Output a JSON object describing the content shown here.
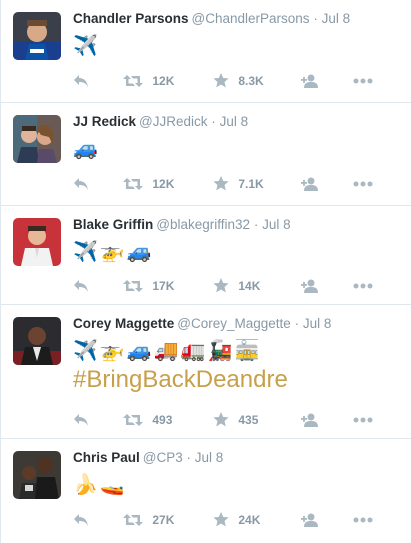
{
  "tweets": [
    {
      "name": "Chandler Parsons",
      "handle": "@ChandlerParsons",
      "sep": "·",
      "time": "Jul 8",
      "emojis": [
        "✈️"
      ],
      "hashtag": "",
      "retweets": "12K",
      "favorites": "8.3K"
    },
    {
      "name": "JJ Redick",
      "handle": "@JJRedick",
      "sep": "·",
      "time": "Jul 8",
      "emojis": [
        "🚙"
      ],
      "hashtag": "",
      "retweets": "12K",
      "favorites": "7.1K"
    },
    {
      "name": "Blake Griffin",
      "handle": "@blakegriffin32",
      "sep": "·",
      "time": "Jul 8",
      "emojis": [
        "✈️",
        "🚁",
        "🚙"
      ],
      "hashtag": "",
      "retweets": "17K",
      "favorites": "14K"
    },
    {
      "name": "Corey Maggette",
      "handle": "@Corey_Maggette",
      "sep": "·",
      "time": "Jul 8",
      "emojis": [
        "✈️",
        "🚁",
        "🚙",
        "🚚",
        "🚛",
        "🚂",
        "🚋"
      ],
      "hashtag": "#BringBackDeandre",
      "retweets": "493",
      "favorites": "435"
    },
    {
      "name": "Chris Paul",
      "handle": "@CP3",
      "sep": "·",
      "time": "Jul 8",
      "emojis": [
        "🍌",
        "🚤"
      ],
      "hashtag": "",
      "retweets": "27K",
      "favorites": "24K"
    }
  ],
  "colors": {
    "icon": "#aab8c2",
    "meta": "#8899a6",
    "name": "#292f33",
    "divider": "#e1e8ed",
    "hashtag": "#c8a04a"
  },
  "icons": {
    "reply": "reply-icon",
    "retweet": "retweet-icon",
    "favorite": "star-icon",
    "follow": "follow-user-icon",
    "more": "more-dots-icon"
  }
}
